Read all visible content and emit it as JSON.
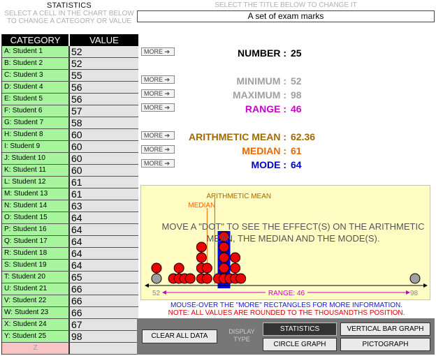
{
  "header": {
    "left_title": "STATISTICS",
    "left_hint": "SELECT A CELL IN THE CHART BELOW TO CHANGE A CATEGORY OR VALUE",
    "title_hint": "SELECT THE TITLE BELOW TO CHANGE IT",
    "title": "A set of exam marks"
  },
  "table": {
    "col_category": "CATEGORY",
    "col_value": "VALUE",
    "rows": [
      {
        "cat": "A: Student 1",
        "val": "52"
      },
      {
        "cat": "B: Student 2",
        "val": "52"
      },
      {
        "cat": "C: Student 3",
        "val": "55"
      },
      {
        "cat": "D: Student 4",
        "val": "56"
      },
      {
        "cat": "E: Student 5",
        "val": "56"
      },
      {
        "cat": "F: Student 6",
        "val": "57"
      },
      {
        "cat": "G: Student 7",
        "val": "58"
      },
      {
        "cat": "H: Student 8",
        "val": "60"
      },
      {
        "cat": "I: Student 9",
        "val": "60"
      },
      {
        "cat": "J: Student 10",
        "val": "60"
      },
      {
        "cat": "K: Student 11",
        "val": "60"
      },
      {
        "cat": "L: Student 12",
        "val": "61"
      },
      {
        "cat": "M: Student 13",
        "val": "61"
      },
      {
        "cat": "N: Student 14",
        "val": "63"
      },
      {
        "cat": "O: Student 15",
        "val": "64"
      },
      {
        "cat": "P: Student 16",
        "val": "64"
      },
      {
        "cat": "Q: Student 17",
        "val": "64"
      },
      {
        "cat": "R: Student 18",
        "val": "64"
      },
      {
        "cat": "S: Student 19",
        "val": "64"
      },
      {
        "cat": "T: Student 20",
        "val": "65"
      },
      {
        "cat": "U: Student 21",
        "val": "66"
      },
      {
        "cat": "V: Student 22",
        "val": "66"
      },
      {
        "cat": "W: Student 23",
        "val": "66"
      },
      {
        "cat": "X: Student 24",
        "val": "67"
      },
      {
        "cat": "Y: Student 25",
        "val": "98"
      },
      {
        "cat": "Z",
        "val": ""
      }
    ]
  },
  "more_label": "MORE",
  "stats": {
    "number": {
      "label": "NUMBER :",
      "value": "25",
      "color": "#000000"
    },
    "minimum": {
      "label": "MINIMUM :",
      "value": "52",
      "color": "#a0a0a0"
    },
    "maximum": {
      "label": "MAXIMUM :",
      "value": "98",
      "color": "#a0a0a0"
    },
    "range": {
      "label": "RANGE :",
      "value": "46",
      "color": "#cc00cc"
    },
    "mean": {
      "label": "ARITHMETIC MEAN :",
      "value": "62.36",
      "color": "#a06a00"
    },
    "median": {
      "label": "MEDIAN :",
      "value": "61",
      "color": "#ee6600"
    },
    "mode": {
      "label": "MODE :",
      "value": "64",
      "color": "#0000cc"
    }
  },
  "chart": {
    "mean_label": "ARITHMETIC MEAN",
    "median_label": "MEDIAN",
    "message": "MOVE A \"DOT\" TO SEE THE EFFECT(S) ON THE ARITHMETIC MEAN, THE MEDIAN AND THE MODE(S).",
    "min_label": "52",
    "max_label": "98",
    "range_label": "RANGE: 46"
  },
  "chart_data": {
    "type": "scatter",
    "x_min": 52,
    "x_max": 98,
    "values": [
      52,
      52,
      55,
      56,
      56,
      57,
      58,
      60,
      60,
      60,
      60,
      61,
      61,
      63,
      64,
      64,
      64,
      64,
      64,
      65,
      66,
      66,
      66,
      67,
      98
    ],
    "mean": 62.36,
    "median": 61,
    "mode": 64,
    "dot_color": "#ee0000",
    "endpoint_color": "#a0a0a0",
    "mode_color": "#0000dd",
    "mean_color": "#a06a00",
    "median_color": "#ee6600"
  },
  "notes": {
    "n1": "MOUSE-OVER THE \"MORE\" RECTANGLES FOR MORE INFORMATION.",
    "n2": "NOTE: ALL VALUES ARE ROUNDED TO THE THOUSANDTHS POSITION."
  },
  "controls": {
    "clear": "CLEAR ALL DATA",
    "display_type": "DISPLAY TYPE",
    "statistics": "STATISTICS",
    "vertical_bar": "VERTICAL BAR GRAPH",
    "circle": "CIRCLE GRAPH",
    "pictograph": "PICTOGRAPH"
  }
}
